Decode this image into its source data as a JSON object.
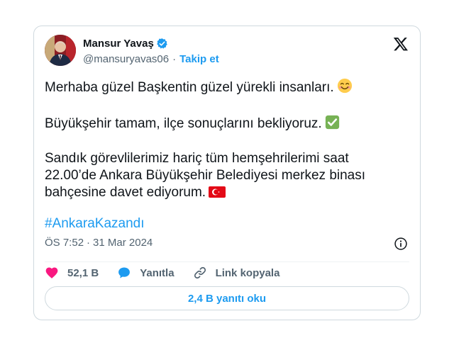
{
  "author": {
    "display_name": "Mansur Yavaş",
    "handle": "@mansuryavas06",
    "separator": "·",
    "follow_label": "Takip et"
  },
  "tweet": {
    "line1": "Merhaba güzel Başkentin güzel yürekli insanları.",
    "line2": "Büyükşehir tamam, ilçe sonuçlarını bekliyoruz.",
    "line3": "Sandık görevlilerimiz hariç tüm hemşehrilerimi saat 22.00’de Ankara Büyükşehir Belediyesi merkez binası bahçesine davet ediyorum.",
    "hashtag": "#AnkaraKazandı"
  },
  "meta": {
    "time": "ÖS 7:52",
    "separator": "·",
    "date": "31 Mar 2024"
  },
  "actions": {
    "likes": "52,1 B",
    "reply_label": "Yanıtla",
    "copy_link_label": "Link kopyala"
  },
  "read_replies_label": "2,4 B yanıtı oku",
  "colors": {
    "accent": "#1d9bf0",
    "like": "#f91880",
    "text": "#0f1419",
    "muted": "#536471",
    "border": "#cfd9de"
  },
  "icons": [
    "verified-badge-icon",
    "x-logo-icon",
    "smiling-face-emoji",
    "check-mark-emoji",
    "turkey-flag-emoji",
    "info-icon",
    "heart-icon",
    "reply-bubble-icon",
    "link-icon"
  ]
}
